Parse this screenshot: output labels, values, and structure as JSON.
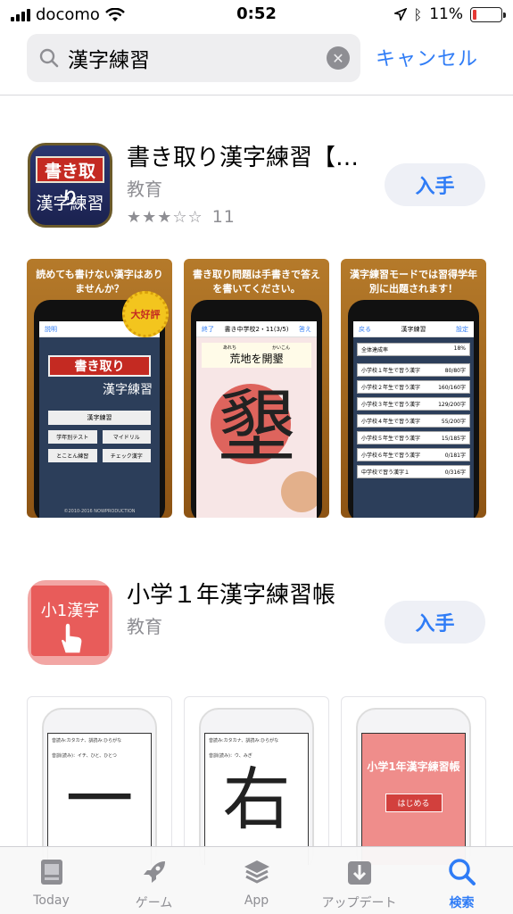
{
  "status": {
    "carrier": "docomo",
    "time": "0:52",
    "battery": "11%"
  },
  "search": {
    "query": "漢字練習",
    "cancel_label": "キャンセル"
  },
  "apps": [
    {
      "title": "書き取り漢字練習【…",
      "category": "教育",
      "get_label": "入手",
      "stars": "★★★☆☆",
      "rating_count": "11",
      "icon_text_top": "書き取り",
      "icon_text_bottom": "漢字練習",
      "screenshots": [
        {
          "caption": "読めても書けない漢字はありませんか？",
          "badge": "大好評",
          "logo_top": "書き取り",
          "logo_bottom": "漢字練習",
          "buttons": [
            "漢字練習",
            "学年別テスト",
            "マイドリル",
            "とことん練習",
            "チェック漢字"
          ],
          "nav_left": "説明",
          "footer": "©2010-2016 NOWPRODUCTION"
        },
        {
          "caption": "書き取り問題は手書きで答えを書いてください。",
          "nav_left": "終了",
          "nav_title": "書き中学校2・11(3/5)",
          "nav_right": "答え",
          "sentence": "荒地を開墾",
          "ruby_left": "あれち",
          "ruby_right": "かいこん",
          "kanji": "墾"
        },
        {
          "caption": "漢字練習モードでは習得学年別に出題されます！",
          "nav_left": "戻る",
          "nav_title": "漢字練習",
          "nav_right": "設定",
          "total_label": "全体達成率",
          "total_value": "18%",
          "rows": [
            {
              "label": "小学校１年生で習う漢字",
              "value": "80/80字"
            },
            {
              "label": "小学校２年生で習う漢字",
              "value": "160/160字"
            },
            {
              "label": "小学校３年生で習う漢字",
              "value": "129/200字"
            },
            {
              "label": "小学校４年生で習う漢字",
              "value": "55/200字"
            },
            {
              "label": "小学校５年生で習う漢字",
              "value": "15/185字"
            },
            {
              "label": "小学校６年生で習う漢字",
              "value": "0/181字"
            },
            {
              "label": "中学校で習う漢字１",
              "value": "0/316字"
            }
          ]
        }
      ]
    },
    {
      "title": "小学１年漢字練習帳",
      "category": "教育",
      "get_label": "入手",
      "icon_text": "小1漢字",
      "screenshots": [
        {
          "line1": "音読み:カタカナ、訓読み:ひらがな",
          "line2": "音訓(読み)：イチ、ひと、ひとつ",
          "kanji": "一"
        },
        {
          "line1": "音読み:カタカナ、訓読み:ひらがな",
          "line2": "音訓(読み)：ウ、みぎ",
          "kanji": "右"
        },
        {
          "title": "小学1年漢字練習帳",
          "start": "はじめる"
        }
      ]
    }
  ],
  "tabs": [
    {
      "label": "Today",
      "icon": "today-icon"
    },
    {
      "label": "ゲーム",
      "icon": "rocket-icon"
    },
    {
      "label": "App",
      "icon": "layers-icon"
    },
    {
      "label": "アップデート",
      "icon": "download-icon"
    },
    {
      "label": "検索",
      "icon": "search-icon",
      "active": true
    }
  ],
  "colors": {
    "accent": "#2f7cf6",
    "battery_low": "#e53935"
  }
}
